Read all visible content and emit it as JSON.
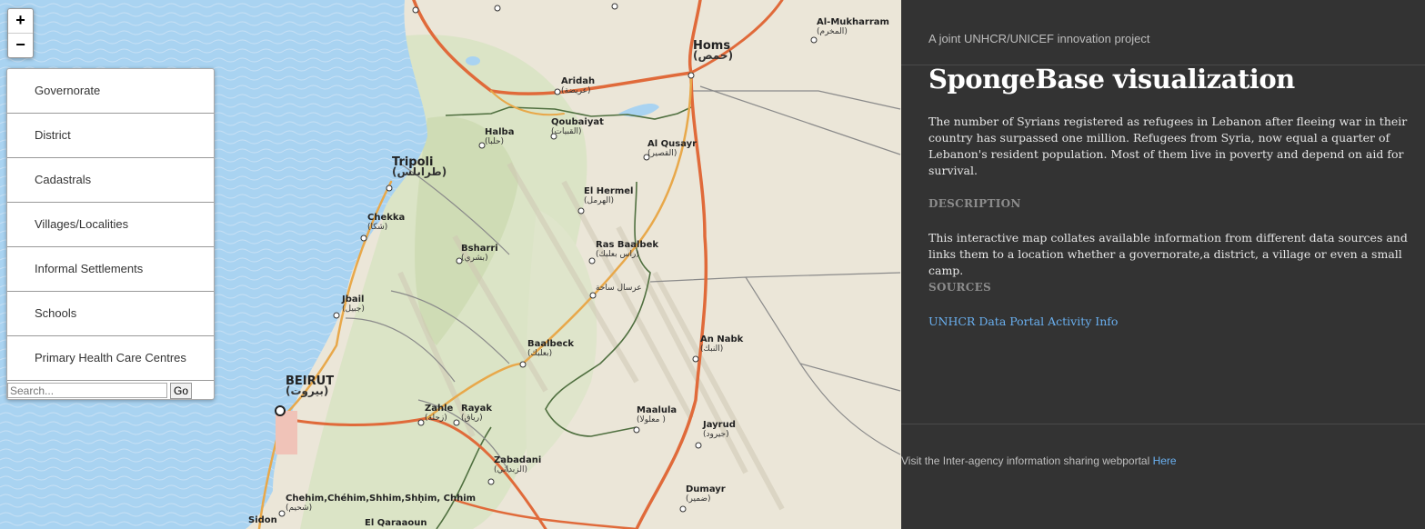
{
  "map": {
    "zoom_in": "+",
    "zoom_out": "−",
    "layers": [
      "Governorate",
      "District",
      "Cadastrals",
      "Villages/Localities",
      "Informal Settlements",
      "Schools",
      "Primary Health Care Centres"
    ],
    "search_placeholder": "Search...",
    "go_label": "Go",
    "places": [
      {
        "en": "Homs",
        "ar": "(حمص)"
      },
      {
        "en": "Al-Mukharram",
        "ar": "(المخرم)"
      },
      {
        "en": "Aridah",
        "ar": "(عريضة)"
      },
      {
        "en": "Qoubaiyat",
        "ar": "(القبيات)"
      },
      {
        "en": "Halba",
        "ar": "(حلبا)"
      },
      {
        "en": "Al Qusayr",
        "ar": "(القصير)"
      },
      {
        "en": "Tripoli",
        "ar": "(طرابلس)"
      },
      {
        "en": "El Hermel",
        "ar": "(الهرمل)"
      },
      {
        "en": "Chekka",
        "ar": "(شكا)"
      },
      {
        "en": "Bsharri",
        "ar": "(بشري)"
      },
      {
        "en": "Ras Baalbek",
        "ar": "(راس بعلبك)"
      },
      {
        "en": "",
        "ar": "عرسال ساحة"
      },
      {
        "en": "Jbail",
        "ar": "(جبيل)"
      },
      {
        "en": "Baalbeck",
        "ar": "(بعلبك)"
      },
      {
        "en": "An Nabk",
        "ar": "(النبك)"
      },
      {
        "en": "BEIRUT",
        "ar": "(بيروت)"
      },
      {
        "en": "Zahle",
        "ar": "(زحلة)"
      },
      {
        "en": "Rayak",
        "ar": "(رياق)"
      },
      {
        "en": "Maalula",
        "ar": "(معلولا )"
      },
      {
        "en": "Jayrud",
        "ar": "(جيرود)"
      },
      {
        "en": "Zabadani",
        "ar": "(الزبداني)"
      },
      {
        "en": "Dumayr",
        "ar": "(ضمير)"
      },
      {
        "en": "Chehim,Chéhim,Shhim,Shḥim, Chhim",
        "ar": "(شحيم)"
      },
      {
        "en": "Sidon",
        "ar": ""
      },
      {
        "en": "El Qaraaoun",
        "ar": ""
      }
    ]
  },
  "panel": {
    "tagline": "A joint UNHCR/UNICEF innovation project",
    "title": "SpongeBase visualization",
    "intro": "The number of Syrians registered as refugees in Lebanon after fleeing war in their country has surpassed one million. Refugees from Syria, now equal a quarter of Lebanon's resident population. Most of them live in poverty and depend on aid for survival.",
    "description_heading": "DESCRIPTION",
    "description": "This interactive map collates available information from different data sources and links them to a location whether a governorate,a district, a village or even a small camp.",
    "sources_heading": "SOURCES",
    "source_link": "UNHCR Data Portal Activity Info",
    "footer_text": "Visit the Inter-agency information sharing webportal ",
    "footer_link": "Here"
  }
}
